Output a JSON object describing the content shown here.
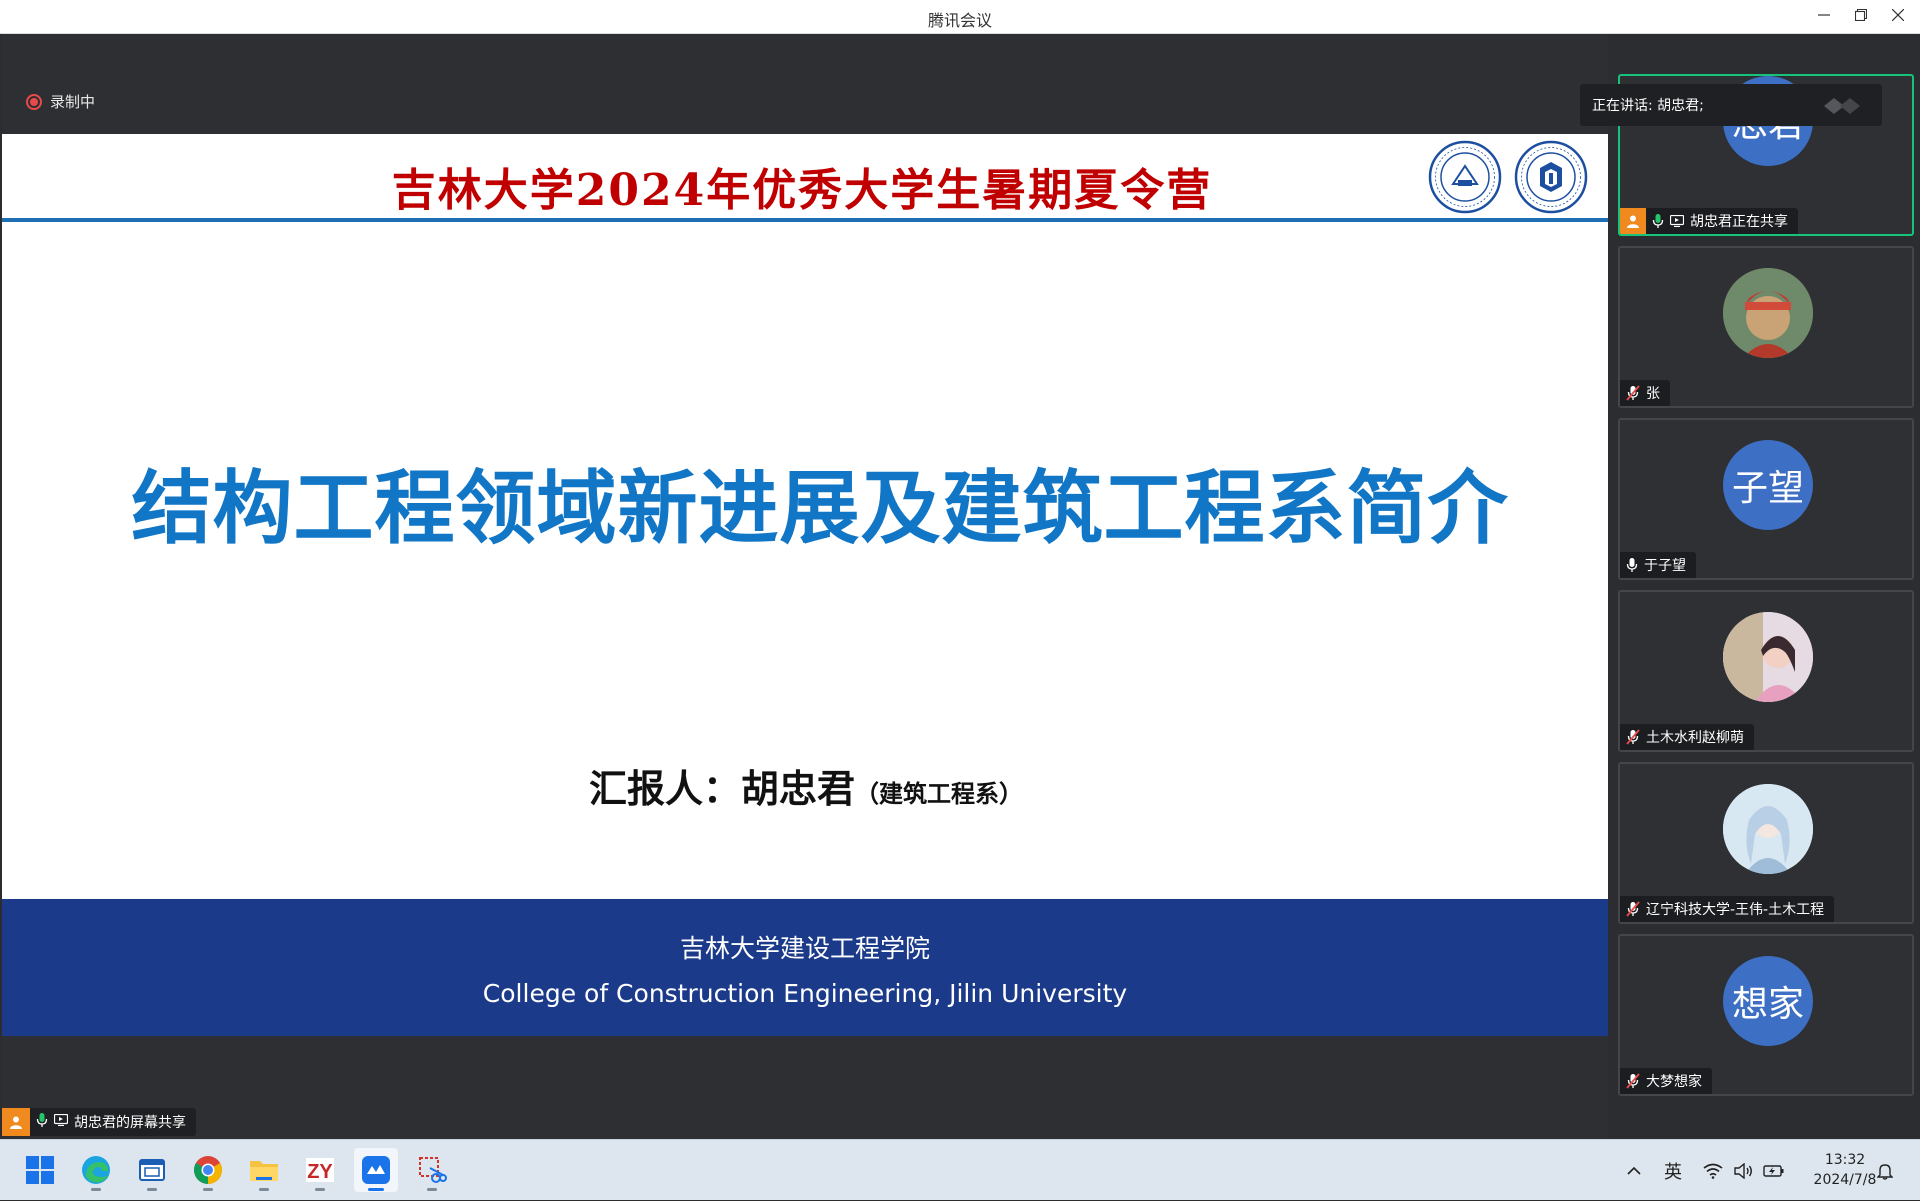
{
  "window": {
    "title": "腾讯会议"
  },
  "recording": {
    "label": "录制中"
  },
  "slide": {
    "camp_title": "吉林大学2024年优秀大学生暑期夏令营",
    "main_title": "结构工程领域新进展及建筑工程系简介",
    "reporter_prefix": "汇报人：胡忠君",
    "reporter_dept": "（建筑工程系）",
    "footer_cn": "吉林大学建设工程学院",
    "footer_en": "College of Construction Engineering, Jilin University"
  },
  "share_tag": {
    "label": "胡忠君的屏幕共享"
  },
  "speaking": {
    "label": "正在讲话:  胡忠君;"
  },
  "participants": [
    {
      "avatar_text": "忠君",
      "label": "胡忠君正在共享",
      "mic": "on",
      "active": true
    },
    {
      "avatar_text": "",
      "label": "张",
      "mic": "muted"
    },
    {
      "avatar_text": "子望",
      "label": "于子望",
      "mic": "on"
    },
    {
      "avatar_text": "",
      "label": "土木水利赵柳萌",
      "mic": "muted"
    },
    {
      "avatar_text": "",
      "label": "辽宁科技大学-王伟-土木工程",
      "mic": "muted"
    },
    {
      "avatar_text": "想家",
      "label": "大梦想家",
      "mic": "muted"
    }
  ],
  "taskbar": {
    "ime": "英",
    "time": "13:32",
    "date": "2024/7/8",
    "apps": [
      "windows-start",
      "edge",
      "app-window",
      "chrome",
      "file-explorer",
      "zy-app",
      "tencent-meeting",
      "snipping-tool"
    ]
  },
  "colors": {
    "camp_title": "#c00000",
    "main_title": "#1176c6",
    "footer_bg": "#1b3a8a",
    "active_border": "#17c27a",
    "avatar_bg": "#3d6fc4"
  }
}
